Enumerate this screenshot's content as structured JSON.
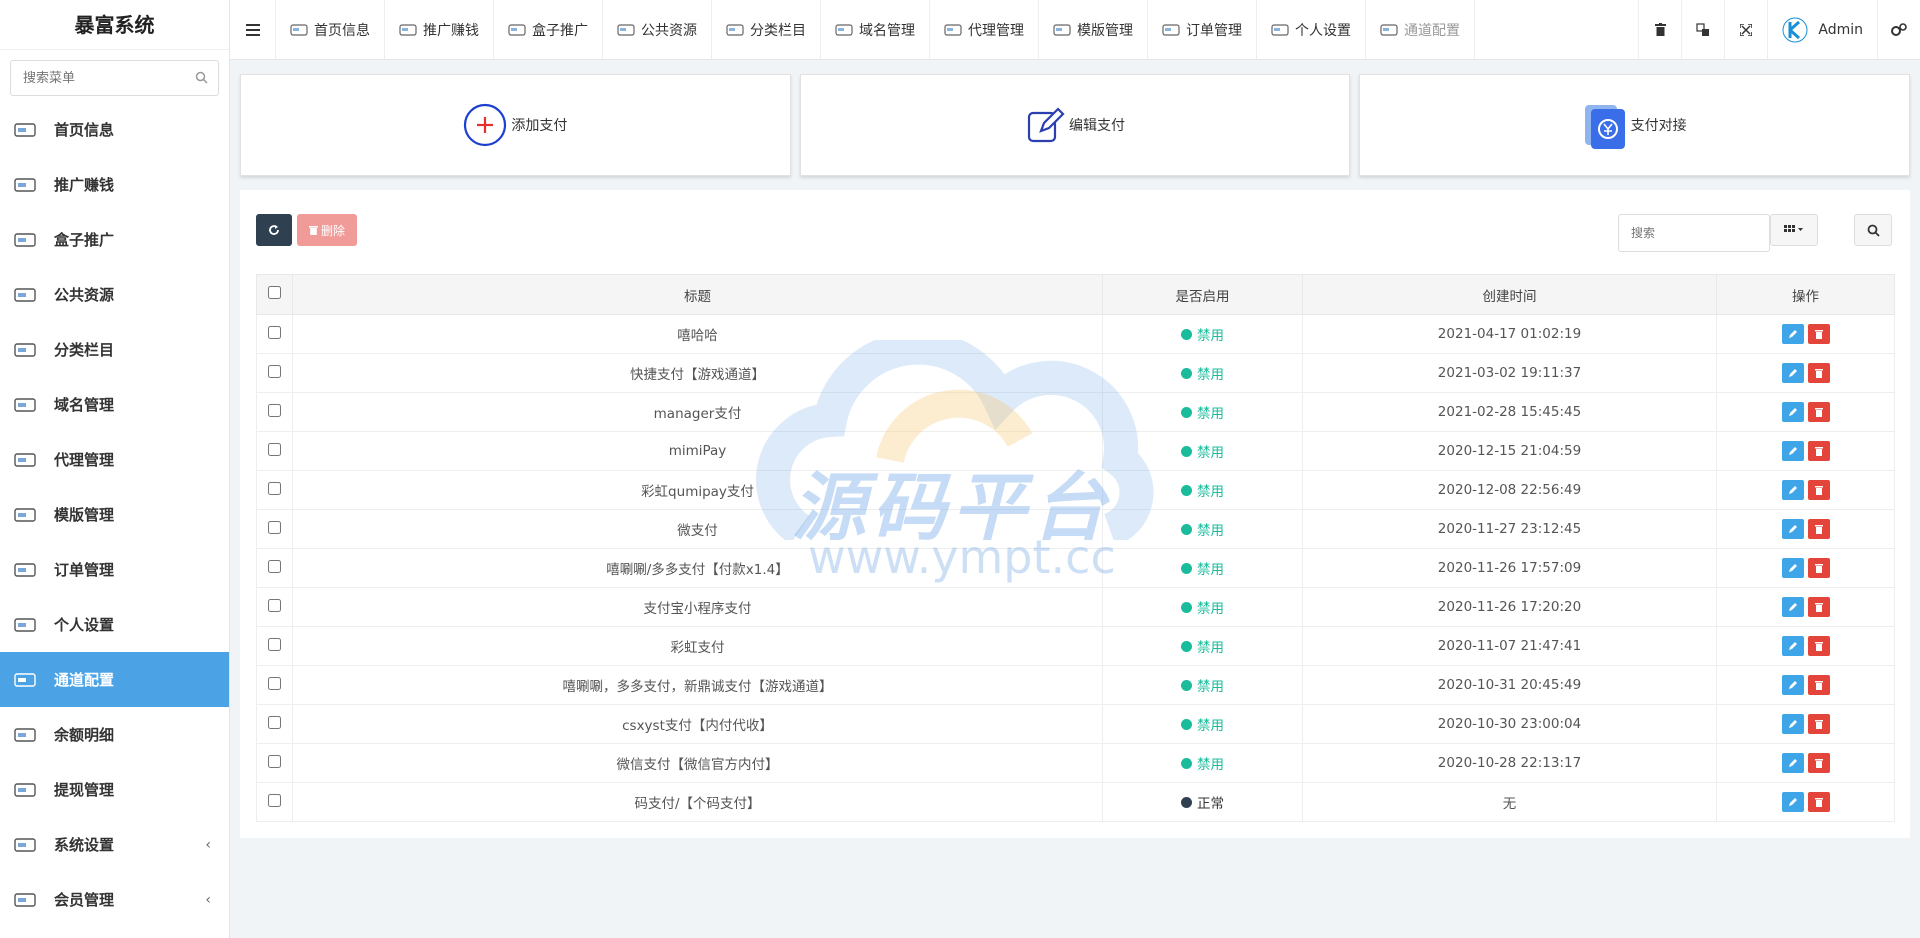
{
  "app": {
    "title": "暴富系统"
  },
  "sidebar": {
    "search_placeholder": "搜索菜单",
    "items": [
      {
        "label": "首页信息",
        "icon": "home-card-icon"
      },
      {
        "label": "推广赚钱",
        "icon": "megaphone-icon"
      },
      {
        "label": "盒子推广",
        "icon": "box-icon"
      },
      {
        "label": "公共资源",
        "icon": "resource-icon"
      },
      {
        "label": "分类栏目",
        "icon": "category-icon"
      },
      {
        "label": "域名管理",
        "icon": "domain-icon"
      },
      {
        "label": "代理管理",
        "icon": "cart-icon"
      },
      {
        "label": "模版管理",
        "icon": "template-icon"
      },
      {
        "label": "订单管理",
        "icon": "order-icon"
      },
      {
        "label": "个人设置",
        "icon": "profile-icon"
      },
      {
        "label": "通道配置",
        "icon": "channel-icon",
        "active": true
      },
      {
        "label": "余额明细",
        "icon": "balance-icon"
      },
      {
        "label": "提现管理",
        "icon": "withdraw-icon"
      },
      {
        "label": "系统设置",
        "icon": "system-icon",
        "caret": "‹"
      },
      {
        "label": "会员管理",
        "icon": "member-icon",
        "caret": "‹"
      }
    ]
  },
  "topnav": {
    "items": [
      {
        "label": "首页信息"
      },
      {
        "label": "推广赚钱"
      },
      {
        "label": "盒子推广"
      },
      {
        "label": "公共资源"
      },
      {
        "label": "分类栏目"
      },
      {
        "label": "域名管理"
      },
      {
        "label": "代理管理"
      },
      {
        "label": "模版管理"
      },
      {
        "label": "订单管理"
      },
      {
        "label": "个人设置"
      },
      {
        "label": "通道配置"
      }
    ],
    "user": "Admin"
  },
  "cards": {
    "add": "添加支付",
    "edit": "编辑支付",
    "connect": "支付对接"
  },
  "toolbar": {
    "delete_label": "删除",
    "search_placeholder": "搜索"
  },
  "table": {
    "headers": {
      "title": "标题",
      "enabled": "是否启用",
      "created": "创建时间",
      "ops": "操作"
    },
    "rows": [
      {
        "title": "嘻哈哈",
        "status": "禁用",
        "time": "2021-04-17 01:02:19"
      },
      {
        "title": "快捷支付【游戏通道】",
        "status": "禁用",
        "time": "2021-03-02 19:11:37"
      },
      {
        "title": "manager支付",
        "status": "禁用",
        "time": "2021-02-28 15:45:45"
      },
      {
        "title": "mimiPay",
        "status": "禁用",
        "time": "2020-12-15 21:04:59"
      },
      {
        "title": "彩虹qumipay支付",
        "status": "禁用",
        "time": "2020-12-08 22:56:49"
      },
      {
        "title": "微支付",
        "status": "禁用",
        "time": "2020-11-27 23:12:45"
      },
      {
        "title": "嘻唰唰/多多支付【付款x1.4】",
        "status": "禁用",
        "time": "2020-11-26 17:57:09"
      },
      {
        "title": "支付宝小程序支付",
        "status": "禁用",
        "time": "2020-11-26 17:20:20"
      },
      {
        "title": "彩虹支付",
        "status": "禁用",
        "time": "2020-11-07 21:47:41"
      },
      {
        "title": "嘻唰唰，多多支付，新鼎诚支付【游戏通道】",
        "status": "禁用",
        "time": "2020-10-31 20:45:49"
      },
      {
        "title": "csxyst支付【内付代收】",
        "status": "禁用",
        "time": "2020-10-30 23:00:04"
      },
      {
        "title": "微信支付【微信官方内付】",
        "status": "禁用",
        "time": "2020-10-28 22:13:17"
      },
      {
        "title": "码支付/【个码支付】",
        "status": "正常",
        "time": "无"
      }
    ]
  },
  "watermark": {
    "text": "源码平台",
    "url": "www.ympt.cc"
  },
  "colors": {
    "accent": "#4ba3e6",
    "disabled_dot": "#1abc9c",
    "disabled_text": "#1abc9c",
    "normal_dot": "#2f4050",
    "edit": "#3da5e8",
    "delete": "#e4453a"
  }
}
